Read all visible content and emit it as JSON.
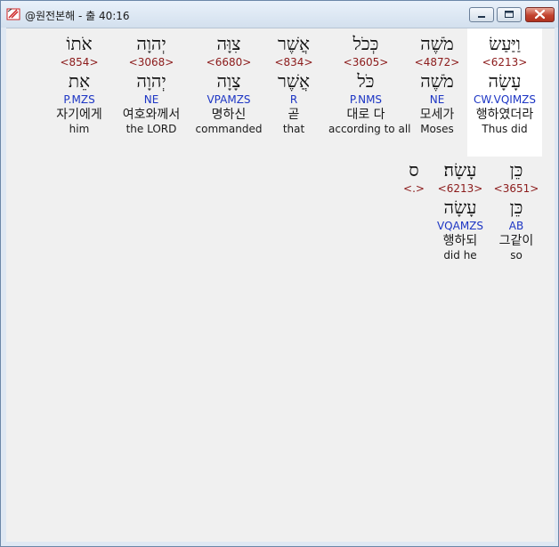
{
  "window": {
    "title": "@원전본해 - 출 40:16"
  },
  "line1": [
    {
      "heb": "וַיַּעַשׂ",
      "strong": "<6213>",
      "lemma": "עָשָׂה",
      "parse": "CW.VQIMZS",
      "ko": "행하였더라",
      "en": "Thus did"
    },
    {
      "heb": "מֹשֶׁה",
      "strong": "<4872>",
      "lemma": "מֹשֶׁה",
      "parse": "NE",
      "ko": "모세가",
      "en": "Moses"
    },
    {
      "heb": "כְּכֹל",
      "strong": "<3605>",
      "lemma": "כֹּל",
      "parse": "P.NMS",
      "ko": "대로 다",
      "en": "according to all"
    },
    {
      "heb": "אֲשֶׁר",
      "strong": "<834>",
      "lemma": "אֲשֶׁר",
      "parse": "R",
      "ko": "곧",
      "en": "that"
    },
    {
      "heb": "צִוָּה",
      "strong": "<6680>",
      "lemma": "צָוָה",
      "parse": "VPAMZS",
      "ko": "명하신",
      "en": "commanded"
    },
    {
      "heb": "יְהוָה",
      "strong": "<3068>",
      "lemma": "יְהוָה",
      "parse": "NE",
      "ko": "여호와께서",
      "en": "the LORD"
    },
    {
      "heb": "אֹתוֹ",
      "strong": "<854>",
      "lemma": "אֵת",
      "parse": "P.MZS",
      "ko": "자기에게",
      "en": "him"
    }
  ],
  "line2": [
    {
      "heb": "כֵּן",
      "strong": "<3651>",
      "lemma": "כֵּן",
      "parse": "AB",
      "ko": "그같이",
      "en": "so"
    },
    {
      "heb": "עָשָׂה׃",
      "strong": "<6213>",
      "lemma": "עָשָׂה",
      "parse": "VQAMZS",
      "ko": "행하되",
      "en": "did he"
    },
    {
      "heb": "ס",
      "strong": "<.>",
      "lemma": "",
      "parse": "",
      "ko": "",
      "en": ""
    }
  ]
}
